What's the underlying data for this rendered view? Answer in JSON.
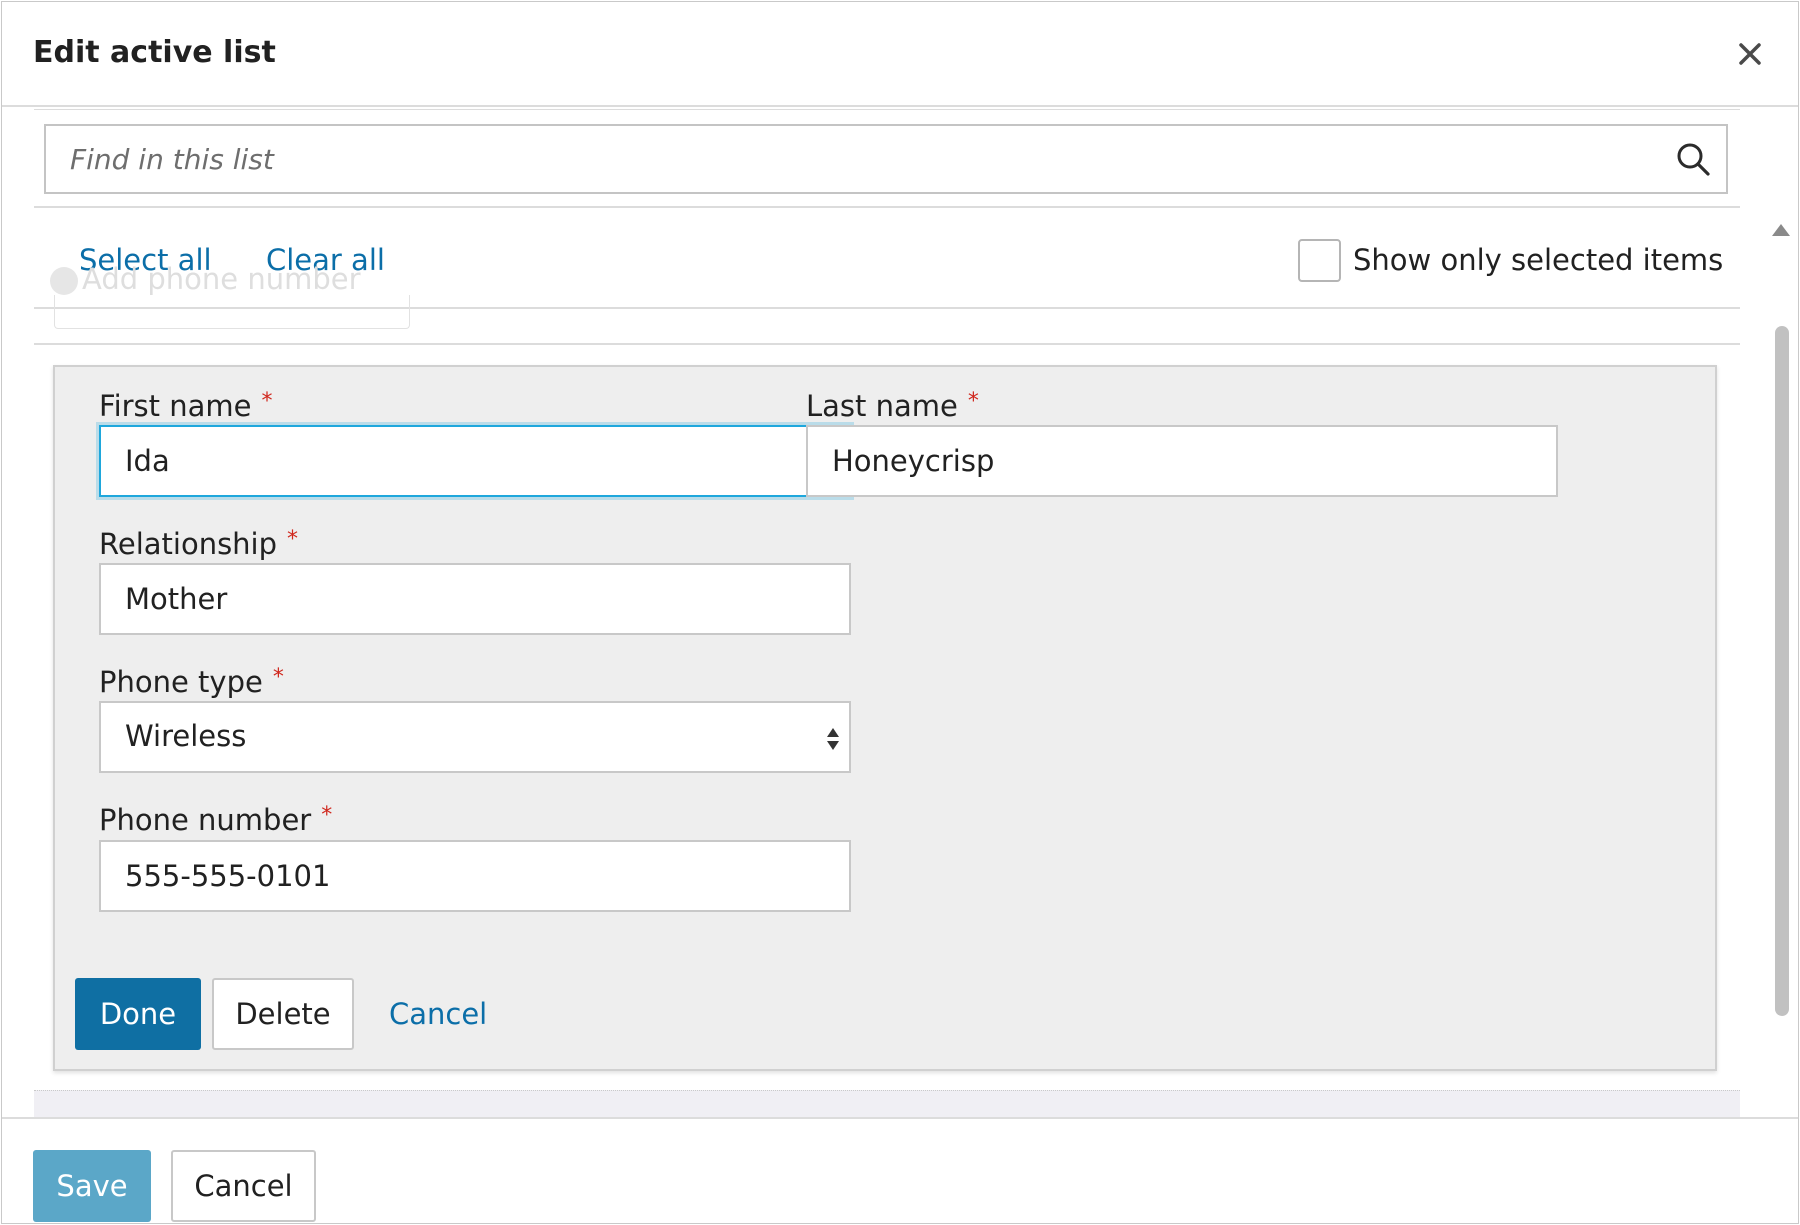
{
  "dialog": {
    "title": "Edit active list"
  },
  "search": {
    "placeholder": "Find in this list"
  },
  "selection": {
    "select_all_label": "Select all",
    "clear_all_label": "Clear all",
    "show_only_selected_label": "Show only selected items",
    "show_only_selected_checked": false
  },
  "behind": {
    "add_phone_label": "Add phone number"
  },
  "form": {
    "first_name": {
      "label": "First name",
      "value": "Ida",
      "required_mark": "*"
    },
    "last_name": {
      "label": "Last name",
      "value": "Honeycrisp",
      "required_mark": "*"
    },
    "relationship": {
      "label": "Relationship",
      "value": "Mother",
      "required_mark": "*"
    },
    "phone_type": {
      "label": "Phone type",
      "value": "Wireless",
      "required_mark": "*"
    },
    "phone_number": {
      "label": "Phone number",
      "value": "555-555-0101",
      "required_mark": "*"
    },
    "done_label": "Done",
    "delete_label": "Delete",
    "cancel_label": "Cancel"
  },
  "footer": {
    "save_label": "Save",
    "cancel_label": "Cancel"
  },
  "icons": {
    "close": "close-icon",
    "search": "search-icon",
    "select_arrows": "sort-arrows-icon"
  },
  "colors": {
    "primary": "#0f6fa3",
    "primary_disabled": "#5ba7c8",
    "link": "#0b6ea8",
    "required": "#d0271d",
    "focus": "#1ea7dc"
  }
}
